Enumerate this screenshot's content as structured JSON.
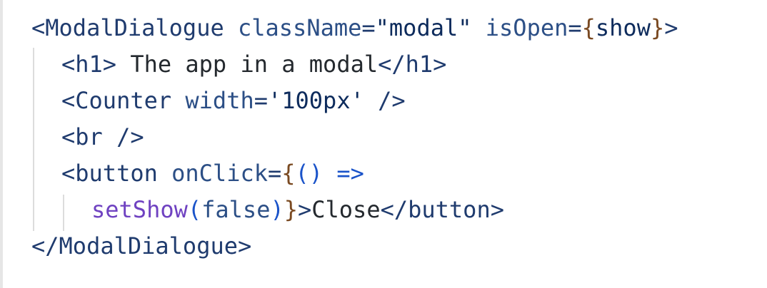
{
  "colors": {
    "tag": "#1f3b6e",
    "attr": "#2c4f86",
    "string": "#0d2b5c",
    "brace": "#7a4a22",
    "paren": "#1a53c9",
    "func": "#6f42c1",
    "text": "#24292e",
    "guide": "#dcdcdc"
  },
  "lines": [
    {
      "indent": 0,
      "tokens": [
        {
          "t": "<ModalDialogue",
          "c": "tag"
        },
        {
          "t": " ",
          "c": "text"
        },
        {
          "t": "className",
          "c": "attr"
        },
        {
          "t": "=",
          "c": "tag"
        },
        {
          "t": "\"modal\"",
          "c": "string"
        },
        {
          "t": " ",
          "c": "text"
        },
        {
          "t": "isOpen",
          "c": "attr"
        },
        {
          "t": "=",
          "c": "tag"
        },
        {
          "t": "{",
          "c": "brace"
        },
        {
          "t": "show",
          "c": "string"
        },
        {
          "t": "}",
          "c": "brace"
        },
        {
          "t": ">",
          "c": "tag"
        }
      ]
    },
    {
      "indent": 1,
      "tokens": [
        {
          "t": "<h1>",
          "c": "tag"
        },
        {
          "t": " The app in a modal",
          "c": "text"
        },
        {
          "t": "</h1>",
          "c": "tag"
        }
      ]
    },
    {
      "indent": 1,
      "tokens": [
        {
          "t": "<Counter",
          "c": "tag"
        },
        {
          "t": " ",
          "c": "text"
        },
        {
          "t": "width",
          "c": "attr"
        },
        {
          "t": "=",
          "c": "tag"
        },
        {
          "t": "'100px'",
          "c": "string"
        },
        {
          "t": " />",
          "c": "tag"
        }
      ]
    },
    {
      "indent": 1,
      "tokens": [
        {
          "t": "<br />",
          "c": "tag"
        }
      ]
    },
    {
      "indent": 1,
      "tokens": [
        {
          "t": "<button",
          "c": "tag"
        },
        {
          "t": " ",
          "c": "text"
        },
        {
          "t": "onClick",
          "c": "attr"
        },
        {
          "t": "=",
          "c": "tag"
        },
        {
          "t": "{",
          "c": "brace"
        },
        {
          "t": "()",
          "c": "paren"
        },
        {
          "t": " ",
          "c": "text"
        },
        {
          "t": "=>",
          "c": "paren"
        }
      ]
    },
    {
      "indent": 2,
      "tokens": [
        {
          "t": "setShow",
          "c": "func"
        },
        {
          "t": "(",
          "c": "paren"
        },
        {
          "t": "false",
          "c": "attr"
        },
        {
          "t": ")",
          "c": "paren"
        },
        {
          "t": "}",
          "c": "brace"
        },
        {
          "t": ">",
          "c": "tag"
        },
        {
          "t": "Close",
          "c": "text"
        },
        {
          "t": "</button>",
          "c": "tag"
        }
      ]
    },
    {
      "indent": 0,
      "tokens": [
        {
          "t": "</ModalDialogue>",
          "c": "tag"
        }
      ]
    }
  ]
}
